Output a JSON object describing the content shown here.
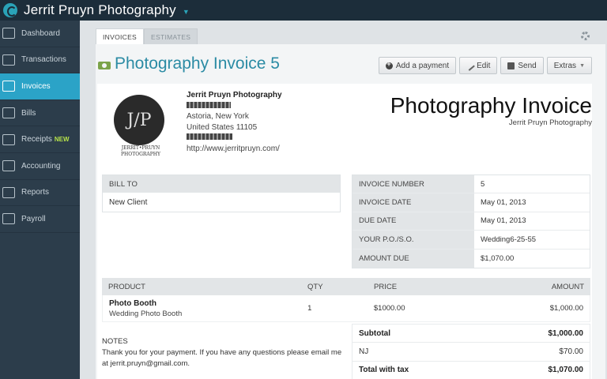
{
  "app": {
    "company_name": "Jerrit Pruyn Photography"
  },
  "sidebar": {
    "items": [
      {
        "label": "Dashboard",
        "icon": "dashboard-icon"
      },
      {
        "label": "Transactions",
        "icon": "list-icon"
      },
      {
        "label": "Invoices",
        "icon": "invoice-icon",
        "active": true
      },
      {
        "label": "Bills",
        "icon": "bill-icon"
      },
      {
        "label": "Receipts",
        "icon": "receipt-icon",
        "badge": "NEW"
      },
      {
        "label": "Accounting",
        "icon": "chart-icon"
      },
      {
        "label": "Reports",
        "icon": "bar-chart-icon"
      },
      {
        "label": "Payroll",
        "icon": "payroll-icon"
      }
    ]
  },
  "tabs": [
    {
      "label": "INVOICES"
    },
    {
      "label": "ESTIMATES"
    }
  ],
  "header": {
    "title": "Photography Invoice 5",
    "buttons": {
      "add_payment": "Add a payment",
      "edit": "Edit",
      "send": "Send",
      "extras": "Extras"
    }
  },
  "invoice": {
    "logo_initials": "J/P",
    "logo_caption_1": "JERRIT•PRUYN",
    "logo_caption_2": "PHOTOGRAPHY",
    "business_name": "Jerrit Pruyn Photography",
    "address_line_city": "Astoria, New York",
    "address_line_country": "United States 11105",
    "website": "http://www.jerritpruyn.com/",
    "doc_title": "Photography Invoice",
    "doc_subtitle": "Jerrit Pruyn Photography",
    "bill_to": {
      "label": "BILL TO",
      "client": "New Client"
    },
    "meta": [
      {
        "key": "INVOICE NUMBER",
        "value": "5"
      },
      {
        "key": "INVOICE DATE",
        "value": "May 01, 2013"
      },
      {
        "key": "DUE DATE",
        "value": "May 01, 2013"
      },
      {
        "key": "YOUR P.O./S.O.",
        "value": "Wedding6-25-55"
      },
      {
        "key": "AMOUNT DUE",
        "value": "$1,070.00"
      }
    ],
    "items_header": {
      "product": "PRODUCT",
      "qty": "QTY",
      "price": "PRICE",
      "amount": "AMOUNT"
    },
    "items": [
      {
        "name": "Photo Booth",
        "desc": "Wedding Photo Booth",
        "qty": "1",
        "price": "$1000.00",
        "amount": "$1,000.00"
      }
    ],
    "notes_label": "NOTES",
    "notes_text": "Thank you for your payment. If you have any questions please email me at jerrit.pruyn@gmail.com.",
    "totals": [
      {
        "label": "Subtotal",
        "value": "$1,000.00",
        "bold": true
      },
      {
        "label": "NJ",
        "value": "$70.00",
        "bold": false
      },
      {
        "label": "Total with tax",
        "value": "$1,070.00",
        "bold": true
      }
    ]
  }
}
